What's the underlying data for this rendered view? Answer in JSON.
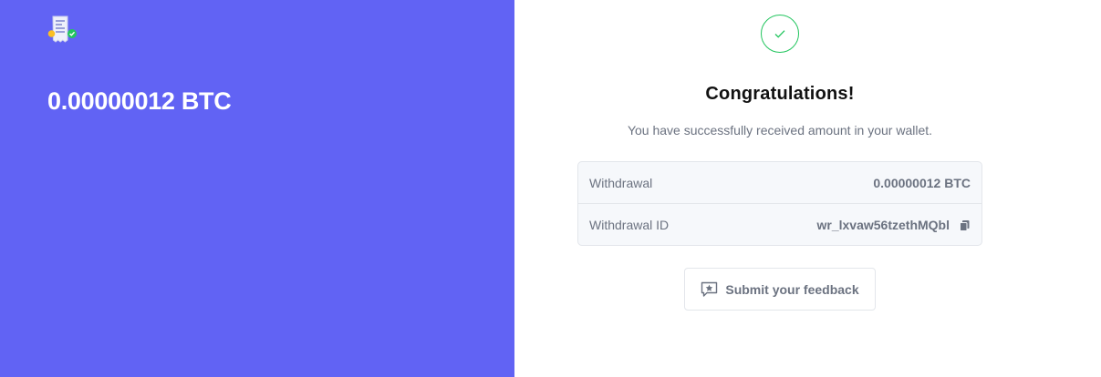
{
  "left": {
    "logo_icon": "receipt-icon",
    "amount": "0.00000012 BTC"
  },
  "success": {
    "icon": "check-icon",
    "title": "Congratulations!",
    "subtitle": "You have successfully received amount in your wallet."
  },
  "details": {
    "rows": [
      {
        "label": "Withdrawal",
        "value": "0.00000012 BTC"
      },
      {
        "label": "Withdrawal ID",
        "value": "wr_lxvaw56tzethMQbl",
        "icon": "copy-icon"
      }
    ]
  },
  "feedback": {
    "icon": "feedback-star-icon",
    "label": "Submit your feedback"
  },
  "colors": {
    "brand": "#6163f4",
    "success": "#22c55e",
    "muted_text": "#6b7280"
  }
}
